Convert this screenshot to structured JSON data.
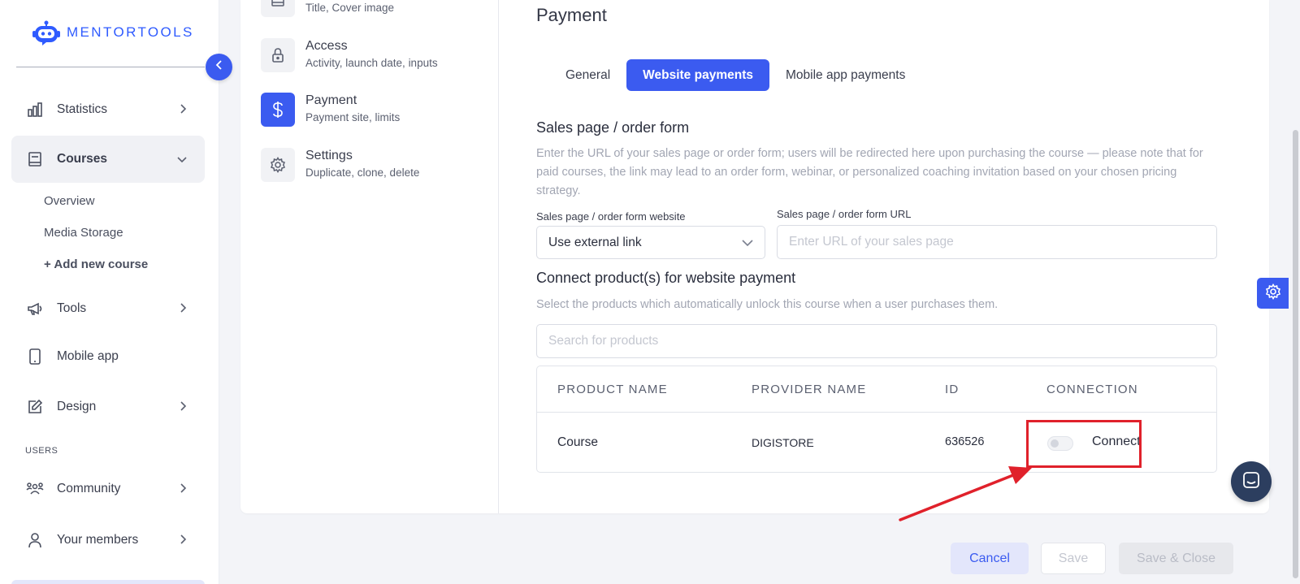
{
  "app": {
    "name": "MENTORTOOLS",
    "accent": "#3b5bf0",
    "highlight": "#e0212b"
  },
  "sidebar": {
    "items": [
      {
        "label": "Statistics",
        "icon": "bar-chart-icon"
      },
      {
        "label": "Courses",
        "icon": "book-icon"
      },
      {
        "label": "Tools",
        "icon": "megaphone-icon"
      },
      {
        "label": "Mobile app",
        "icon": "phone-icon"
      },
      {
        "label": "Design",
        "icon": "pencil-icon"
      },
      {
        "label": "Community",
        "icon": "people-icon"
      },
      {
        "label": "Your members",
        "icon": "user-icon"
      }
    ],
    "sub_items": [
      "Overview",
      "Media Storage",
      "+ Add new course"
    ],
    "section_users": "USERS"
  },
  "steps": [
    {
      "title": "",
      "subtitle": "Title, Cover image",
      "icon": "image-icon"
    },
    {
      "title": "Access",
      "subtitle": "Activity, launch date, inputs",
      "icon": "lock-icon"
    },
    {
      "title": "Payment",
      "subtitle": "Payment site, limits",
      "icon": "dollar-icon"
    },
    {
      "title": "Settings",
      "subtitle": "Duplicate, clone, delete",
      "icon": "gear-icon"
    }
  ],
  "main": {
    "title": "Payment",
    "tabs": [
      "General",
      "Website payments",
      "Mobile app payments"
    ],
    "sales": {
      "title": "Sales page / order form",
      "description": "Enter the URL of your sales page or order form; users will be redirected here upon purchasing the course — please note that for paid courses, the link may lead to an order form, webinar, or personalized coaching invitation based on your chosen pricing strategy.",
      "website_label": "Sales page / order form website",
      "website_value": "Use external link",
      "url_label": "Sales page / order form URL",
      "url_placeholder": "Enter URL of your sales page"
    },
    "products": {
      "title": "Connect product(s) for website payment",
      "description": "Select the products which automatically unlock this course when a user purchases them.",
      "search_placeholder": "Search for products",
      "columns": [
        "PRODUCT NAME",
        "PROVIDER NAME",
        "ID",
        "CONNECTION"
      ],
      "rows": [
        {
          "product": "Course",
          "provider": "DIGISTORE",
          "id": "636526",
          "connect_label": "Connect",
          "connected": false
        }
      ]
    }
  },
  "footer": {
    "cancel": "Cancel",
    "save": "Save",
    "save_close": "Save & Close"
  }
}
